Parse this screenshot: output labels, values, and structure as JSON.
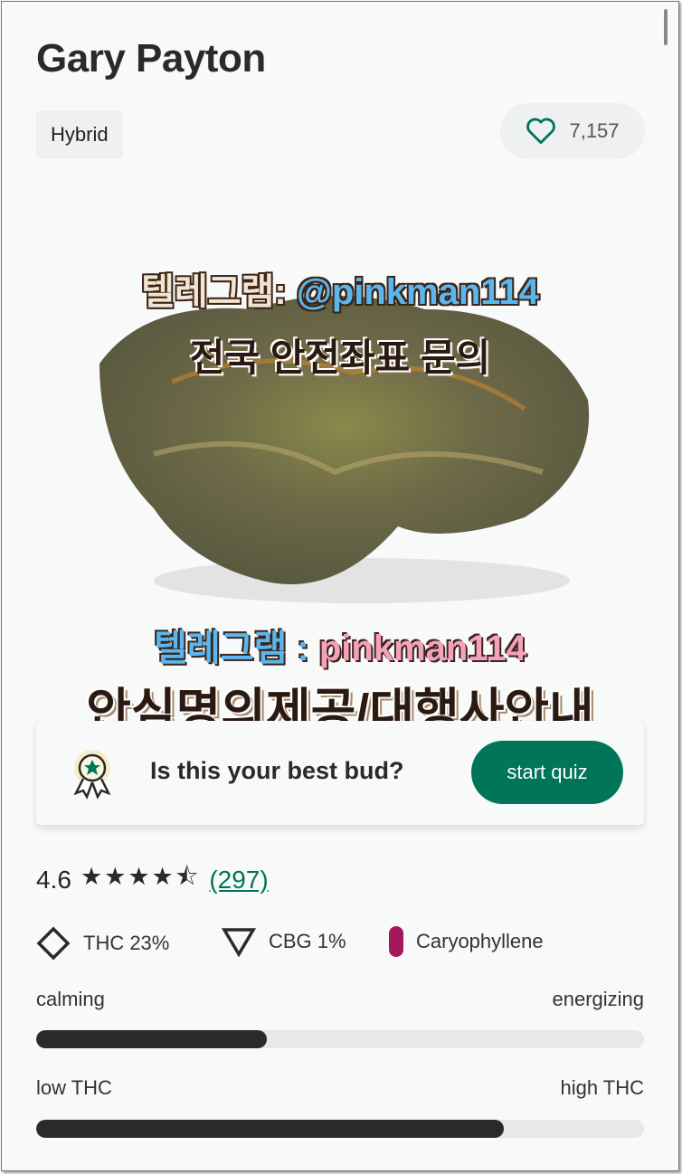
{
  "strain": {
    "name": "Gary Payton",
    "type": "Hybrid",
    "likes": "7,157"
  },
  "image_overlay": {
    "line1_prefix": "텔레그램:",
    "line1_handle": "@pinkman114",
    "line2": "전국 안전좌표 문의",
    "line3_prefix": "텔레그램 :",
    "line3_handle": "pinkman114",
    "line4": "안심명의제공/대행사안내"
  },
  "quiz": {
    "question": "Is this your best bud?",
    "button": "start quiz"
  },
  "rating": {
    "value": "4.6",
    "stars": 4.6,
    "stars_text": "★★★★⯪",
    "count": "(297)"
  },
  "chemistry": [
    {
      "icon": "diamond-icon",
      "label": "THC 23%"
    },
    {
      "icon": "triangle-icon",
      "label": "CBG 1%"
    },
    {
      "icon": "terpene-pill-icon",
      "label": "Caryophyllene",
      "color": "#a3195b"
    }
  ],
  "effects": [
    {
      "left": "calming",
      "right": "energizing",
      "level": 0.38
    },
    {
      "left": "low THC",
      "right": "high THC",
      "level": 0.77
    }
  ],
  "colors": {
    "accent": "#017559",
    "text": "#2a2a2a"
  }
}
